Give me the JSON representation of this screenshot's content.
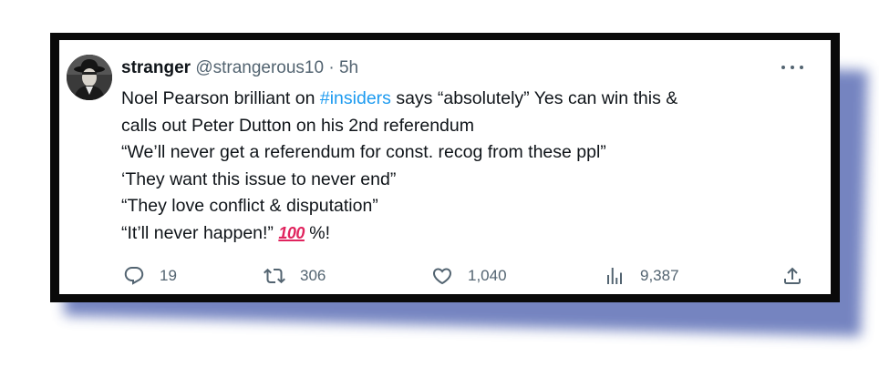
{
  "tweet": {
    "display_name": "stranger",
    "handle": "@strangerous10",
    "separator": "·",
    "time": "5h",
    "more_icon": "more-horizontal-icon",
    "text": {
      "line1_before": "Noel Pearson brilliant on ",
      "hashtag": "#insiders",
      "line1_after": " says “absolutely” Yes can win this &",
      "line2": "calls out Peter Dutton on his 2nd referendum",
      "line3": "“We’ll never get a referendum for const. recog from these ppl”",
      "line4": "‘They want this issue to never end”",
      "line5": "“They love conflict & disputation”",
      "line6_before": "“It’ll never happen!” ",
      "emoji": "100",
      "line6_after": " %!"
    },
    "actions": {
      "replies": "19",
      "retweets": "306",
      "likes": "1,040",
      "views": "9,387"
    }
  },
  "colors": {
    "text_primary": "#0f1419",
    "text_secondary": "#536471",
    "link": "#1d9bf0",
    "emoji_red": "#e0245e",
    "frame": "#0a0a0a",
    "shadow": "#5d6fb6"
  }
}
